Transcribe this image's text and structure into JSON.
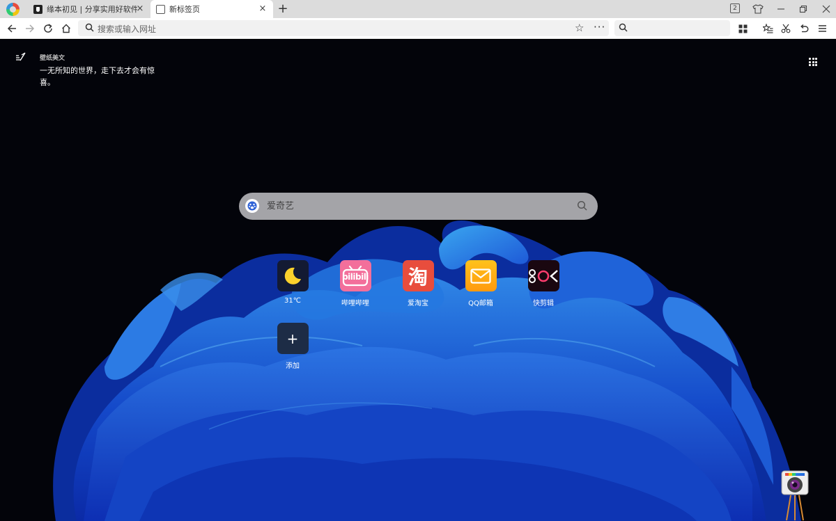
{
  "tabs": [
    {
      "title": "缘本初见 | 分享实用好软件!",
      "close": "×"
    },
    {
      "title": "新标签页",
      "close": "×"
    }
  ],
  "tabstrip": {
    "new_tab": "+",
    "tab_count": "2"
  },
  "toolbar": {
    "address_placeholder": "搜索或输入网址",
    "more": "···"
  },
  "wallpaper": {
    "title": "壁纸美文",
    "text": "一无所知的世界，走下去才会有惊喜。"
  },
  "search": {
    "placeholder": "爱奇艺",
    "engine_icon": "baidu-paw-icon"
  },
  "shortcuts": [
    {
      "label": "31℃",
      "icon": "moon-icon"
    },
    {
      "label": "哔哩哔哩",
      "icon_text": "bilibili"
    },
    {
      "label": "爱淘宝",
      "icon_text": "淘"
    },
    {
      "label": "QQ邮箱",
      "icon": "mail-icon"
    },
    {
      "label": "快剪辑",
      "icon": "kuaijianji-icon"
    },
    {
      "label": "添加",
      "icon_text": "+"
    }
  ],
  "colors": {
    "accent_blue": "#1f5bd8",
    "tab_bg": "#dcdcdc",
    "background": "#03040a"
  }
}
